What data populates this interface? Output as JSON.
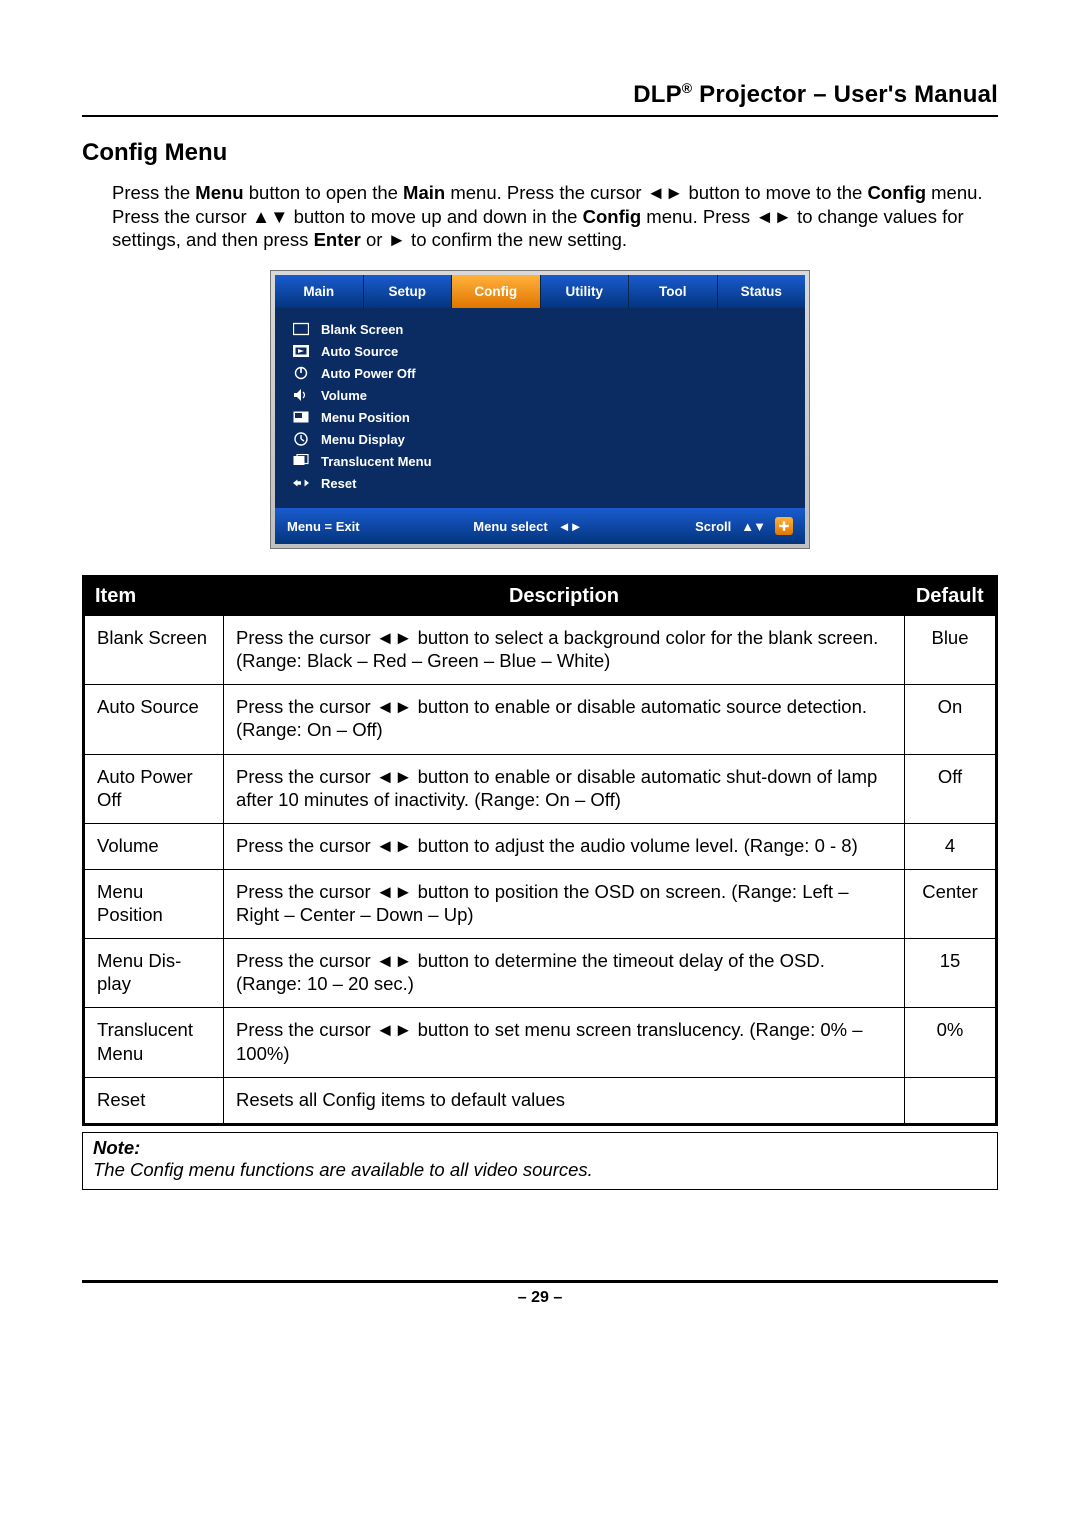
{
  "header": {
    "brand_prefix": "DLP",
    "brand_super": "®",
    "title_rest": " Projector – User's Manual"
  },
  "section_title": "Config Menu",
  "intro": {
    "p1_a": "Press the ",
    "p1_b": "Menu",
    "p1_c": " button to open the ",
    "p1_d": "Main",
    "p1_e": " menu. Press the cursor ",
    "p1_arrows_lr": "◄►",
    "p1_f": " button to move to the ",
    "p1_g": "Config",
    "p1_h": " menu. Press the cursor ",
    "p1_arrows_ud": "▲▼",
    "p1_i": " button to move up and down in the ",
    "p1_j": "Config",
    "p1_k": " menu. Press ",
    "p1_arrows_lr2": "◄►",
    "p1_l": " to change values for settings, and then press ",
    "p1_m": "Enter",
    "p1_n": " or ",
    "p1_arrow_r": "►",
    "p1_o": " to confirm the new setting."
  },
  "osd": {
    "tabs": [
      "Main",
      "Setup",
      "Config",
      "Utility",
      "Tool",
      "Status"
    ],
    "active_tab_index": 2,
    "items": [
      {
        "icon": "blank",
        "label": "Blank Screen"
      },
      {
        "icon": "source",
        "label": "Auto Source"
      },
      {
        "icon": "power",
        "label": "Auto Power Off"
      },
      {
        "icon": "speaker",
        "label": "Volume"
      },
      {
        "icon": "position",
        "label": "Menu Position"
      },
      {
        "icon": "clock",
        "label": "Menu Display"
      },
      {
        "icon": "translucent",
        "label": "Translucent Menu"
      },
      {
        "icon": "reset",
        "label": "Reset"
      }
    ],
    "footer": {
      "exit": "Menu = Exit",
      "select": "Menu select",
      "select_glyph": "◄►",
      "scroll": "Scroll",
      "scroll_glyph": "▲▼"
    }
  },
  "table": {
    "head": {
      "item": "Item",
      "desc": "Description",
      "def": "Default"
    },
    "rows": [
      {
        "item": "Blank Screen",
        "desc_a": "Press the cursor ",
        "desc_arrows": "◄►",
        "desc_b": " button to select a background color for the blank screen. (Range: Black – Red – Green – Blue – White)",
        "def": "Blue"
      },
      {
        "item": "Auto Source",
        "desc_a": "Press the cursor ",
        "desc_arrows": "◄►",
        "desc_b": " button to enable or disable automatic source detection. (Range: On – Off)",
        "def": "On"
      },
      {
        "item": "Auto Power Off",
        "desc_a": "Press the cursor ",
        "desc_arrows": "◄►",
        "desc_b": " button to enable or disable automatic shut-down of lamp after 10 minutes of inactivity. (Range: On – Off)",
        "def": "Off"
      },
      {
        "item": "Volume",
        "desc_a": "Press the cursor ",
        "desc_arrows": "◄►",
        "desc_b": " button to adjust the audio volume level. (Range: 0 - 8)",
        "def": "4"
      },
      {
        "item": "Menu Position",
        "desc_a": "Press the cursor ",
        "desc_arrows": "◄►",
        "desc_b": " button to position the OSD on screen. (Range: Left – Right – Center – Down – Up)",
        "def": "Center"
      },
      {
        "item": "Menu Dis-play",
        "desc_a": "Press the cursor ",
        "desc_arrows": "◄►",
        "desc_b": " button to determine the timeout delay of the OSD.\n(Range: 10 – 20 sec.)",
        "def": "15"
      },
      {
        "item": "Translucent Menu",
        "desc_a": "Press the cursor ",
        "desc_arrows": "◄►",
        "desc_b": " button to set menu screen translucency. (Range: 0% – 100%)",
        "def": "0%"
      },
      {
        "item": "Reset",
        "desc_a": "Resets all Config items to default values",
        "desc_arrows": "",
        "desc_b": "",
        "def": ""
      }
    ]
  },
  "note": {
    "label": "Note:",
    "text": "The Config menu functions are available to all video sources."
  },
  "page_number": "– 29 –"
}
